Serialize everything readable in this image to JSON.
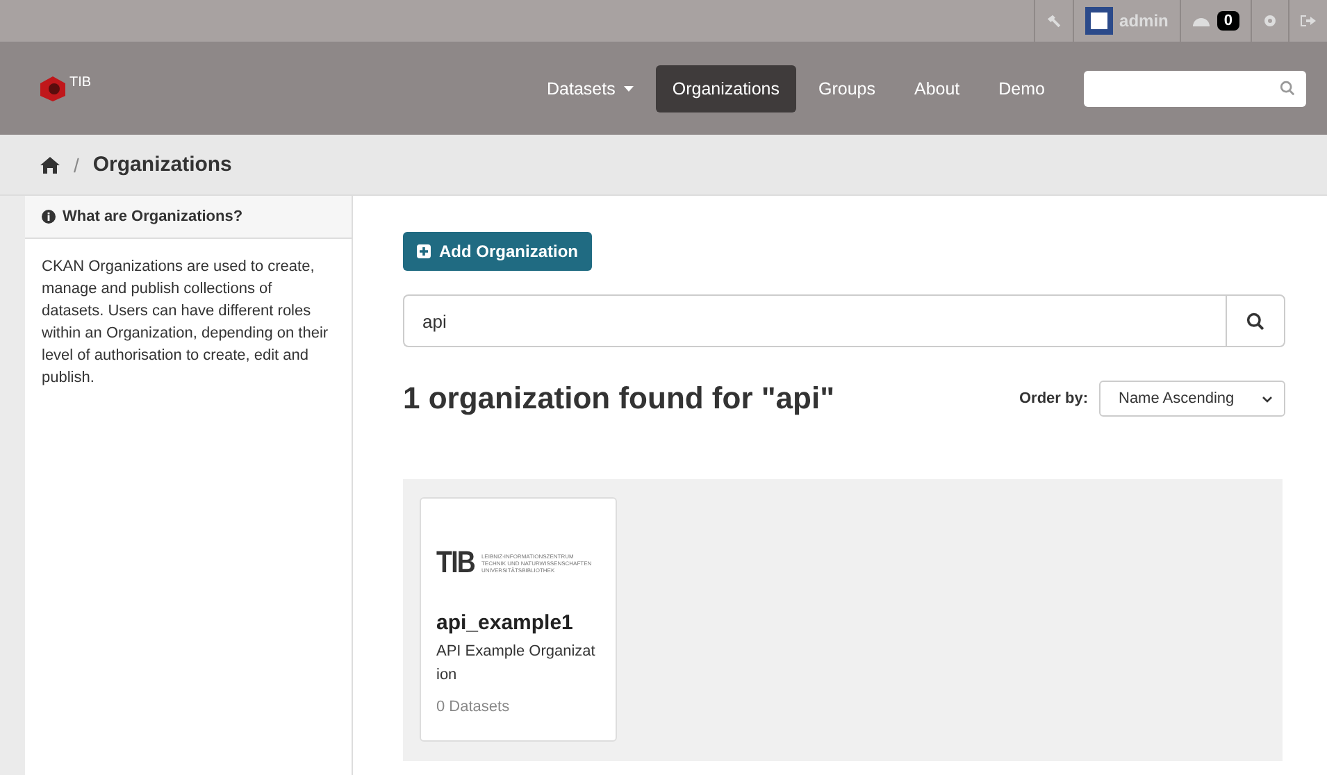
{
  "account_bar": {
    "username": "admin",
    "badge": "0"
  },
  "header": {
    "logo_text": "TIB",
    "nav": [
      {
        "label": "Datasets",
        "selected": false,
        "dropdown": true
      },
      {
        "label": "Organizations",
        "selected": true,
        "dropdown": false
      },
      {
        "label": "Groups",
        "selected": false,
        "dropdown": false
      },
      {
        "label": "About",
        "selected": false,
        "dropdown": false
      },
      {
        "label": "Demo",
        "selected": false,
        "dropdown": false
      }
    ]
  },
  "breadcrumb": {
    "separator": "/",
    "current": "Organizations"
  },
  "sidebar": {
    "title": "What are Organizations?",
    "text": "CKAN Organizations are used to create, manage and publish collections of datasets. Users can have different roles within an Organization, depending on their level of authorisation to create, edit and publish."
  },
  "main": {
    "add_button": "Add Organization",
    "search": {
      "value": "api"
    },
    "result_heading": "1 organization found for \"api\"",
    "order_label": "Order by:",
    "order_value": "Name Ascending",
    "organizations": [
      {
        "logo_text": "TIB",
        "logo_lines": [
          "LEIBNIZ-INFORMATIONSZENTRUM",
          "TECHNIK UND NATURWISSENSCHAFTEN",
          "UNIVERSITÄTSBIBLIOTHEK"
        ],
        "name": "api_example1",
        "description": "API Example Organizat ion",
        "count": "0 Datasets"
      }
    ]
  }
}
